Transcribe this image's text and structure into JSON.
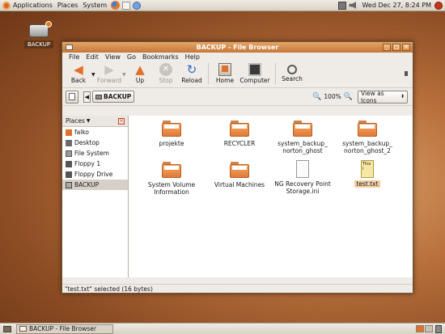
{
  "top_panel": {
    "menus": [
      "Applications",
      "Places",
      "System"
    ],
    "clock": "Wed Dec 27,  8:24 PM"
  },
  "desktop": {
    "drive_label": "BACKUP"
  },
  "window": {
    "title": "BACKUP - File Browser",
    "menu": [
      "File",
      "Edit",
      "View",
      "Go",
      "Bookmarks",
      "Help"
    ],
    "toolbar": {
      "back": "Back",
      "forward": "Forward",
      "up": "Up",
      "stop": "Stop",
      "reload": "Reload",
      "home": "Home",
      "computer": "Computer",
      "search": "Search"
    },
    "location": {
      "path_button": "BACKUP",
      "zoom": "100%",
      "view_mode": "View as Icons"
    },
    "sidebar": {
      "header": "Places",
      "items": [
        "falko",
        "Desktop",
        "File System",
        "Floppy 1",
        "Floppy Drive",
        "BACKUP"
      ]
    },
    "files": [
      {
        "name": "projekte",
        "type": "folder"
      },
      {
        "name": "RECYCLER",
        "type": "folder"
      },
      {
        "name": "system_backup_\nnorton_ghost",
        "type": "folder"
      },
      {
        "name": "system_backup_\nnorton_ghost_2",
        "type": "folder"
      },
      {
        "name": "System Volume\nInformation",
        "type": "folder"
      },
      {
        "name": "Virtual Machines",
        "type": "folder"
      },
      {
        "name": "NG Recovery Point\nStorage.ini",
        "type": "ini"
      },
      {
        "name": "test.txt",
        "type": "txt",
        "selected": true
      }
    ],
    "txt_preview": "This i",
    "status": "\"test.txt\" selected (16 bytes)"
  },
  "bottom_panel": {
    "task": "BACKUP - File Browser"
  }
}
